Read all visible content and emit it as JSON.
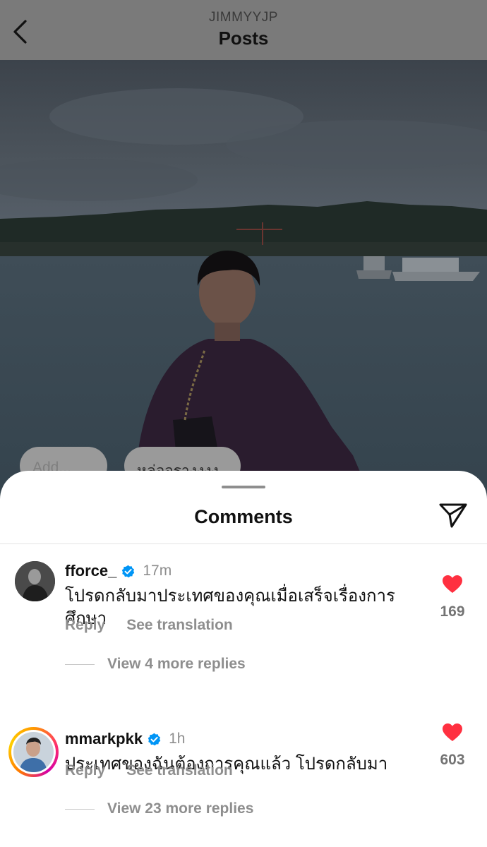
{
  "header": {
    "username": "JIMMYYJP",
    "title": "Posts",
    "back_icon": "chevron-left-icon"
  },
  "post": {
    "image_icon": "photo-of-person-by-lake",
    "chips": [
      {
        "label": "Add..."
      },
      {
        "label": "หล่อจรางงงง"
      }
    ]
  },
  "comments_sheet": {
    "title": "Comments",
    "send_icon": "paper-plane-icon",
    "items": [
      {
        "username": "fforce_",
        "verified": true,
        "time": "17m",
        "text": "โปรดกลับมาประเทศของคุณเมื่อเสร็จเรื่องการศึกษา",
        "reply_label": "Reply",
        "translation_label": "See translation",
        "likes": "169",
        "liked": true,
        "view_replies": "View 4 more replies"
      },
      {
        "username": "mmarkpkk",
        "verified": true,
        "time": "1h",
        "text": "ประเทศของฉันต้องการคุณแล้ว โปรดกลับมา",
        "reply_label": "Reply",
        "translation_label": "See translation",
        "likes": "603",
        "liked": true,
        "view_replies": "View 23 more replies"
      }
    ]
  },
  "colors": {
    "heart": "#ff3040",
    "verified": "#0095f6",
    "muted_text": "#8e8e8e",
    "header_overlay": "#7a7a7a"
  }
}
